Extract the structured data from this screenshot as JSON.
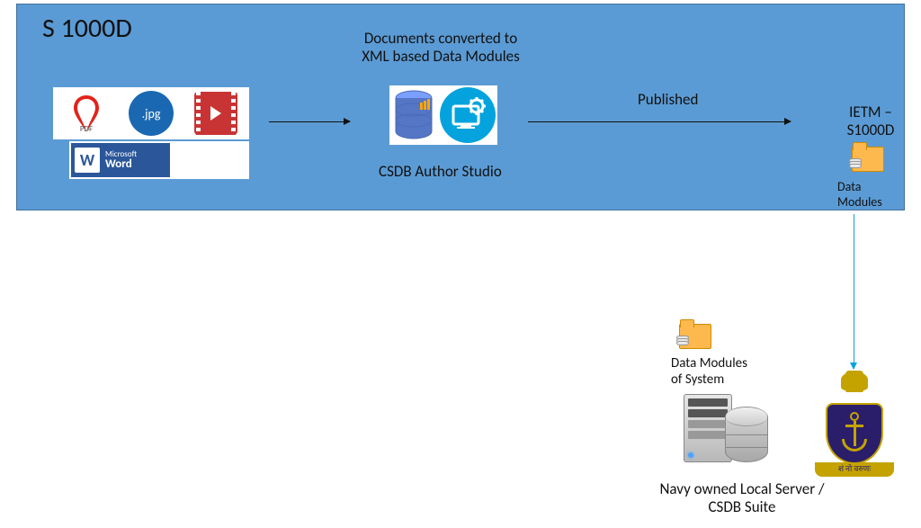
{
  "title": "S 1000D",
  "docs_label_l1": "Documents converted to",
  "docs_label_l2": "XML based  Data Modules",
  "csdb_label": "CSDB Author Studio",
  "published": "Published",
  "ietm_l1": "IETM –",
  "ietm_l2": "S1000D",
  "dm_label": "Data Modules",
  "jpg_text": ".jpg",
  "pdf_text": "PDF",
  "word_small": "Microsoft",
  "word_big": "Word",
  "dm_system_l1": "Data Modules",
  "dm_system_l2": "of System",
  "navy_l1": "Navy owned Local Server /",
  "navy_l2": "CSDB Suite",
  "motto": "शं नो वरुणः"
}
